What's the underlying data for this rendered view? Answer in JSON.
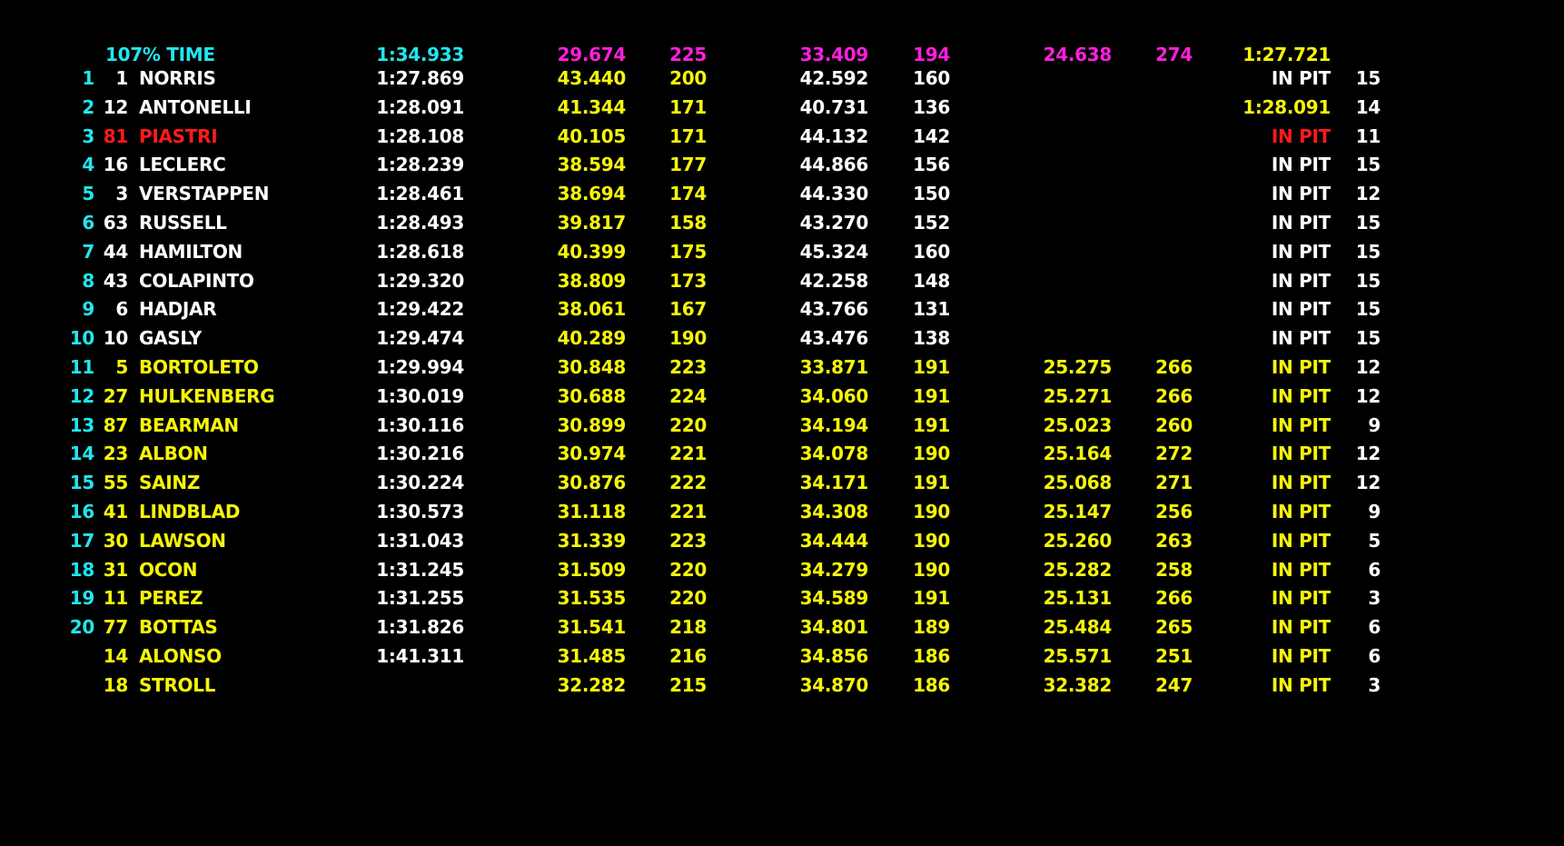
{
  "colors": {
    "background": "#000000",
    "cyan": "#21e6ee",
    "white": "#ffffff",
    "yellow": "#f5f50a",
    "magenta": "#ff1fdc",
    "red": "#ff1a1a"
  },
  "reference_row": {
    "label": "107% TIME",
    "best_lap": "1:34.933",
    "s1": "29.674",
    "sp1": "225",
    "s2": "33.409",
    "sp2": "194",
    "s3": "24.638",
    "sp3": "274",
    "pit": "1:27.721"
  },
  "rows": [
    {
      "pos": "1",
      "num": "1",
      "name": "NORRIS",
      "best": "1:27.869",
      "s1": "43.440",
      "sp1": "200",
      "s2": "42.592",
      "sp2": "160",
      "s3": "",
      "sp3": "",
      "pit": "IN PIT",
      "laps": "15",
      "name_color": "white",
      "pit_color": "white"
    },
    {
      "pos": "2",
      "num": "12",
      "name": "ANTONELLI",
      "best": "1:28.091",
      "s1": "41.344",
      "sp1": "171",
      "s2": "40.731",
      "sp2": "136",
      "s3": "",
      "sp3": "",
      "pit": "1:28.091",
      "laps": "14",
      "name_color": "white",
      "pit_color": "yellow"
    },
    {
      "pos": "3",
      "num": "81",
      "name": "PIASTRI",
      "best": "1:28.108",
      "s1": "40.105",
      "sp1": "171",
      "s2": "44.132",
      "sp2": "142",
      "s3": "",
      "sp3": "",
      "pit": "IN PIT",
      "laps": "11",
      "name_color": "red",
      "pit_color": "red"
    },
    {
      "pos": "4",
      "num": "16",
      "name": "LECLERC",
      "best": "1:28.239",
      "s1": "38.594",
      "sp1": "177",
      "s2": "44.866",
      "sp2": "156",
      "s3": "",
      "sp3": "",
      "pit": "IN PIT",
      "laps": "15",
      "name_color": "white",
      "pit_color": "white"
    },
    {
      "pos": "5",
      "num": "3",
      "name": "VERSTAPPEN",
      "best": "1:28.461",
      "s1": "38.694",
      "sp1": "174",
      "s2": "44.330",
      "sp2": "150",
      "s3": "",
      "sp3": "",
      "pit": "IN PIT",
      "laps": "12",
      "name_color": "white",
      "pit_color": "white"
    },
    {
      "pos": "6",
      "num": "63",
      "name": "RUSSELL",
      "best": "1:28.493",
      "s1": "39.817",
      "sp1": "158",
      "s2": "43.270",
      "sp2": "152",
      "s3": "",
      "sp3": "",
      "pit": "IN PIT",
      "laps": "15",
      "name_color": "white",
      "pit_color": "white"
    },
    {
      "pos": "7",
      "num": "44",
      "name": "HAMILTON",
      "best": "1:28.618",
      "s1": "40.399",
      "sp1": "175",
      "s2": "45.324",
      "sp2": "160",
      "s3": "",
      "sp3": "",
      "pit": "IN PIT",
      "laps": "15",
      "name_color": "white",
      "pit_color": "white"
    },
    {
      "pos": "8",
      "num": "43",
      "name": "COLAPINTO",
      "best": "1:29.320",
      "s1": "38.809",
      "sp1": "173",
      "s2": "42.258",
      "sp2": "148",
      "s3": "",
      "sp3": "",
      "pit": "IN PIT",
      "laps": "15",
      "name_color": "white",
      "pit_color": "white"
    },
    {
      "pos": "9",
      "num": "6",
      "name": "HADJAR",
      "best": "1:29.422",
      "s1": "38.061",
      "sp1": "167",
      "s2": "43.766",
      "sp2": "131",
      "s3": "",
      "sp3": "",
      "pit": "IN PIT",
      "laps": "15",
      "name_color": "white",
      "pit_color": "white"
    },
    {
      "pos": "10",
      "num": "10",
      "name": "GASLY",
      "best": "1:29.474",
      "s1": "40.289",
      "sp1": "190",
      "s2": "43.476",
      "sp2": "138",
      "s3": "",
      "sp3": "",
      "pit": "IN PIT",
      "laps": "15",
      "name_color": "white",
      "pit_color": "white"
    },
    {
      "pos": "11",
      "num": "5",
      "name": "BORTOLETO",
      "best": "1:29.994",
      "s1": "30.848",
      "sp1": "223",
      "s2": "33.871",
      "sp2": "191",
      "s3": "25.275",
      "sp3": "266",
      "pit": "IN PIT",
      "laps": "12",
      "name_color": "yellow",
      "pit_color": "yellow"
    },
    {
      "pos": "12",
      "num": "27",
      "name": "HULKENBERG",
      "best": "1:30.019",
      "s1": "30.688",
      "sp1": "224",
      "s2": "34.060",
      "sp2": "191",
      "s3": "25.271",
      "sp3": "266",
      "pit": "IN PIT",
      "laps": "12",
      "name_color": "yellow",
      "pit_color": "yellow"
    },
    {
      "pos": "13",
      "num": "87",
      "name": "BEARMAN",
      "best": "1:30.116",
      "s1": "30.899",
      "sp1": "220",
      "s2": "34.194",
      "sp2": "191",
      "s3": "25.023",
      "sp3": "260",
      "pit": "IN PIT",
      "laps": "9",
      "name_color": "yellow",
      "pit_color": "yellow"
    },
    {
      "pos": "14",
      "num": "23",
      "name": "ALBON",
      "best": "1:30.216",
      "s1": "30.974",
      "sp1": "221",
      "s2": "34.078",
      "sp2": "190",
      "s3": "25.164",
      "sp3": "272",
      "pit": "IN PIT",
      "laps": "12",
      "name_color": "yellow",
      "pit_color": "yellow"
    },
    {
      "pos": "15",
      "num": "55",
      "name": "SAINZ",
      "best": "1:30.224",
      "s1": "30.876",
      "sp1": "222",
      "s2": "34.171",
      "sp2": "191",
      "s3": "25.068",
      "sp3": "271",
      "pit": "IN PIT",
      "laps": "12",
      "name_color": "yellow",
      "pit_color": "yellow"
    },
    {
      "pos": "16",
      "num": "41",
      "name": "LINDBLAD",
      "best": "1:30.573",
      "s1": "31.118",
      "sp1": "221",
      "s2": "34.308",
      "sp2": "190",
      "s3": "25.147",
      "sp3": "256",
      "pit": "IN PIT",
      "laps": "9",
      "name_color": "yellow",
      "pit_color": "yellow"
    },
    {
      "pos": "17",
      "num": "30",
      "name": "LAWSON",
      "best": "1:31.043",
      "s1": "31.339",
      "sp1": "223",
      "s2": "34.444",
      "sp2": "190",
      "s3": "25.260",
      "sp3": "263",
      "pit": "IN PIT",
      "laps": "5",
      "name_color": "yellow",
      "pit_color": "yellow"
    },
    {
      "pos": "18",
      "num": "31",
      "name": "OCON",
      "best": "1:31.245",
      "s1": "31.509",
      "sp1": "220",
      "s2": "34.279",
      "sp2": "190",
      "s3": "25.282",
      "sp3": "258",
      "pit": "IN PIT",
      "laps": "6",
      "name_color": "yellow",
      "pit_color": "yellow"
    },
    {
      "pos": "19",
      "num": "11",
      "name": "PEREZ",
      "best": "1:31.255",
      "s1": "31.535",
      "sp1": "220",
      "s2": "34.589",
      "sp2": "191",
      "s3": "25.131",
      "sp3": "266",
      "pit": "IN PIT",
      "laps": "3",
      "name_color": "yellow",
      "pit_color": "yellow"
    },
    {
      "pos": "20",
      "num": "77",
      "name": "BOTTAS",
      "best": "1:31.826",
      "s1": "31.541",
      "sp1": "218",
      "s2": "34.801",
      "sp2": "189",
      "s3": "25.484",
      "sp3": "265",
      "pit": "IN PIT",
      "laps": "6",
      "name_color": "yellow",
      "pit_color": "yellow"
    },
    {
      "pos": "",
      "num": "14",
      "name": "ALONSO",
      "best": "1:41.311",
      "s1": "31.485",
      "sp1": "216",
      "s2": "34.856",
      "sp2": "186",
      "s3": "25.571",
      "sp3": "251",
      "pit": "IN PIT",
      "laps": "6",
      "name_color": "yellow",
      "pit_color": "yellow"
    },
    {
      "pos": "",
      "num": "18",
      "name": "STROLL",
      "best": "",
      "s1": "32.282",
      "sp1": "215",
      "s2": "34.870",
      "sp2": "186",
      "s3": "32.382",
      "sp3": "247",
      "pit": "IN PIT",
      "laps": "3",
      "name_color": "yellow",
      "pit_color": "yellow"
    }
  ]
}
